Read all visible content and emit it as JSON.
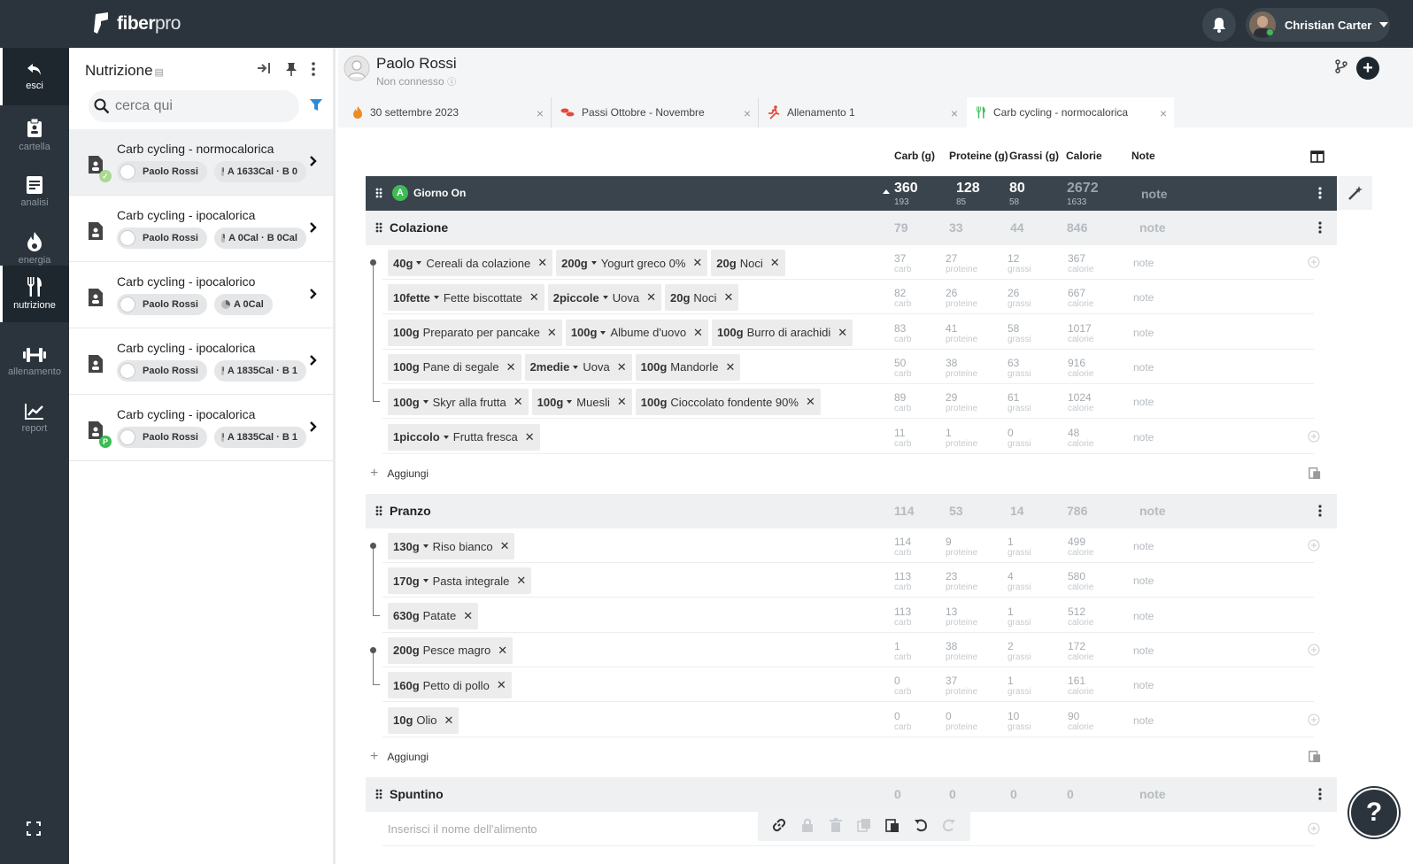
{
  "app": {
    "brand": "fiber",
    "brand2": "pro",
    "user": "Christian Carter"
  },
  "nav": [
    {
      "label": "esci",
      "icon": "back-arrow-icon"
    },
    {
      "label": "cartella",
      "icon": "clipboard-icon"
    },
    {
      "label": "analisi",
      "icon": "notes-icon"
    },
    {
      "label": "energia",
      "icon": "flame-icon"
    },
    {
      "label": "nutrizione",
      "icon": "cutlery-icon"
    },
    {
      "label": "allenamento",
      "icon": "dumbbell-icon"
    },
    {
      "label": "report",
      "icon": "chart-icon"
    }
  ],
  "panel": {
    "title": "Nutrizione",
    "search_placeholder": "cerca qui",
    "items": [
      {
        "name": "Carb cycling - normocalorica",
        "person": "Paolo Rossi",
        "cal": "A 1633Cal · B 0"
      },
      {
        "name": "Carb cycling - ipocalorica",
        "person": "Paolo Rossi",
        "cal": "A 0Cal · B 0Cal"
      },
      {
        "name": "Carb cycling - ipocalorico",
        "person": "Paolo Rossi",
        "cal": "A 0Cal"
      },
      {
        "name": "Carb cycling - ipocalorica",
        "person": "Paolo Rossi",
        "cal": "A 1835Cal · B 1"
      },
      {
        "name": "Carb cycling - ipocalorica",
        "person": "Paolo Rossi",
        "cal": "A 1835Cal · B 1"
      }
    ]
  },
  "patient": {
    "name": "Paolo Rossi",
    "status": "Non connesso"
  },
  "tabs": [
    {
      "label": "30 settembre 2023",
      "icon": "flame-icon"
    },
    {
      "label": "Passi Ottobre - Novembre",
      "icon": "footsteps-icon"
    },
    {
      "label": "Allenamento 1",
      "icon": "runner-icon"
    },
    {
      "label": "Carb cycling - normocalorica",
      "icon": "cutlery-icon"
    }
  ],
  "columns": {
    "carb": "Carb (g)",
    "prot": "Proteine (g)",
    "fat": "Grassi (g)",
    "cal": "Calorie",
    "note": "Note"
  },
  "day": {
    "badge": "A",
    "name": "Giorno On",
    "carb": "360",
    "carb_sub": "193",
    "prot": "128",
    "prot_sub": "85",
    "fat": "80",
    "fat_sub": "58",
    "cal": "2672",
    "cal_sub": "1633",
    "note": "note"
  },
  "labels": {
    "carb": "carb",
    "prot": "proteine",
    "fat": "grassi",
    "cal": "calorie",
    "note": "note",
    "add": "Aggiungi",
    "input_placeholder": "Inserisci il nome dell'alimento"
  },
  "meals": [
    {
      "name": "Colazione",
      "carb": "79",
      "prot": "33",
      "fat": "44",
      "cal": "846",
      "note": "note",
      "rows": [
        {
          "foods": [
            {
              "q": "40g",
              "n": "Cereali da colazione",
              "dd": true
            },
            {
              "q": "200g",
              "n": "Yogurt greco 0%",
              "dd": true
            },
            {
              "q": "20g",
              "n": "Noci",
              "dd": false
            }
          ],
          "carb": "37",
          "prot": "27",
          "fat": "12",
          "cal": "367"
        },
        {
          "foods": [
            {
              "q": "10fette",
              "n": "Fette biscottate",
              "dd": true
            },
            {
              "q": "2piccole",
              "n": "Uova",
              "dd": true
            },
            {
              "q": "20g",
              "n": "Noci",
              "dd": false
            }
          ],
          "carb": "82",
          "prot": "26",
          "fat": "26",
          "cal": "667"
        },
        {
          "foods": [
            {
              "q": "100g",
              "n": "Preparato per pancake",
              "dd": false
            },
            {
              "q": "100g",
              "n": "Albume d'uovo",
              "dd": true
            },
            {
              "q": "100g",
              "n": "Burro di arachidi",
              "dd": false
            }
          ],
          "carb": "83",
          "prot": "41",
          "fat": "58",
          "cal": "1017"
        },
        {
          "foods": [
            {
              "q": "100g",
              "n": "Pane di segale",
              "dd": false
            },
            {
              "q": "2medie",
              "n": "Uova",
              "dd": true
            },
            {
              "q": "100g",
              "n": "Mandorle",
              "dd": false
            }
          ],
          "carb": "50",
          "prot": "38",
          "fat": "63",
          "cal": "916"
        },
        {
          "foods": [
            {
              "q": "100g",
              "n": "Skyr alla frutta",
              "dd": true
            },
            {
              "q": "100g",
              "n": "Muesli",
              "dd": true
            },
            {
              "q": "100g",
              "n": "Cioccolato fondente 90%",
              "dd": false
            }
          ],
          "carb": "89",
          "prot": "29",
          "fat": "61",
          "cal": "1024"
        },
        {
          "foods": [
            {
              "q": "1piccolo",
              "n": "Frutta fresca",
              "dd": true
            }
          ],
          "carb": "11",
          "prot": "1",
          "fat": "0",
          "cal": "48"
        }
      ]
    },
    {
      "name": "Pranzo",
      "carb": "114",
      "prot": "53",
      "fat": "14",
      "cal": "786",
      "note": "note",
      "rows": [
        {
          "foods": [
            {
              "q": "130g",
              "n": "Riso bianco",
              "dd": true
            }
          ],
          "carb": "114",
          "prot": "9",
          "fat": "1",
          "cal": "499"
        },
        {
          "foods": [
            {
              "q": "170g",
              "n": "Pasta integrale",
              "dd": true
            }
          ],
          "carb": "113",
          "prot": "23",
          "fat": "4",
          "cal": "580"
        },
        {
          "foods": [
            {
              "q": "630g",
              "n": "Patate",
              "dd": false
            }
          ],
          "carb": "113",
          "prot": "13",
          "fat": "1",
          "cal": "512"
        },
        {
          "foods": [
            {
              "q": "200g",
              "n": "Pesce magro",
              "dd": false
            }
          ],
          "carb": "1",
          "prot": "38",
          "fat": "2",
          "cal": "172"
        },
        {
          "foods": [
            {
              "q": "160g",
              "n": "Petto di pollo",
              "dd": false
            }
          ],
          "carb": "0",
          "prot": "37",
          "fat": "1",
          "cal": "161"
        },
        {
          "foods": [
            {
              "q": "10g",
              "n": "Olio",
              "dd": false
            }
          ],
          "carb": "0",
          "prot": "0",
          "fat": "10",
          "cal": "90"
        }
      ]
    },
    {
      "name": "Spuntino",
      "carb": "0",
      "prot": "0",
      "fat": "0",
      "cal": "0",
      "note": "note",
      "rows": []
    }
  ],
  "help": "?"
}
